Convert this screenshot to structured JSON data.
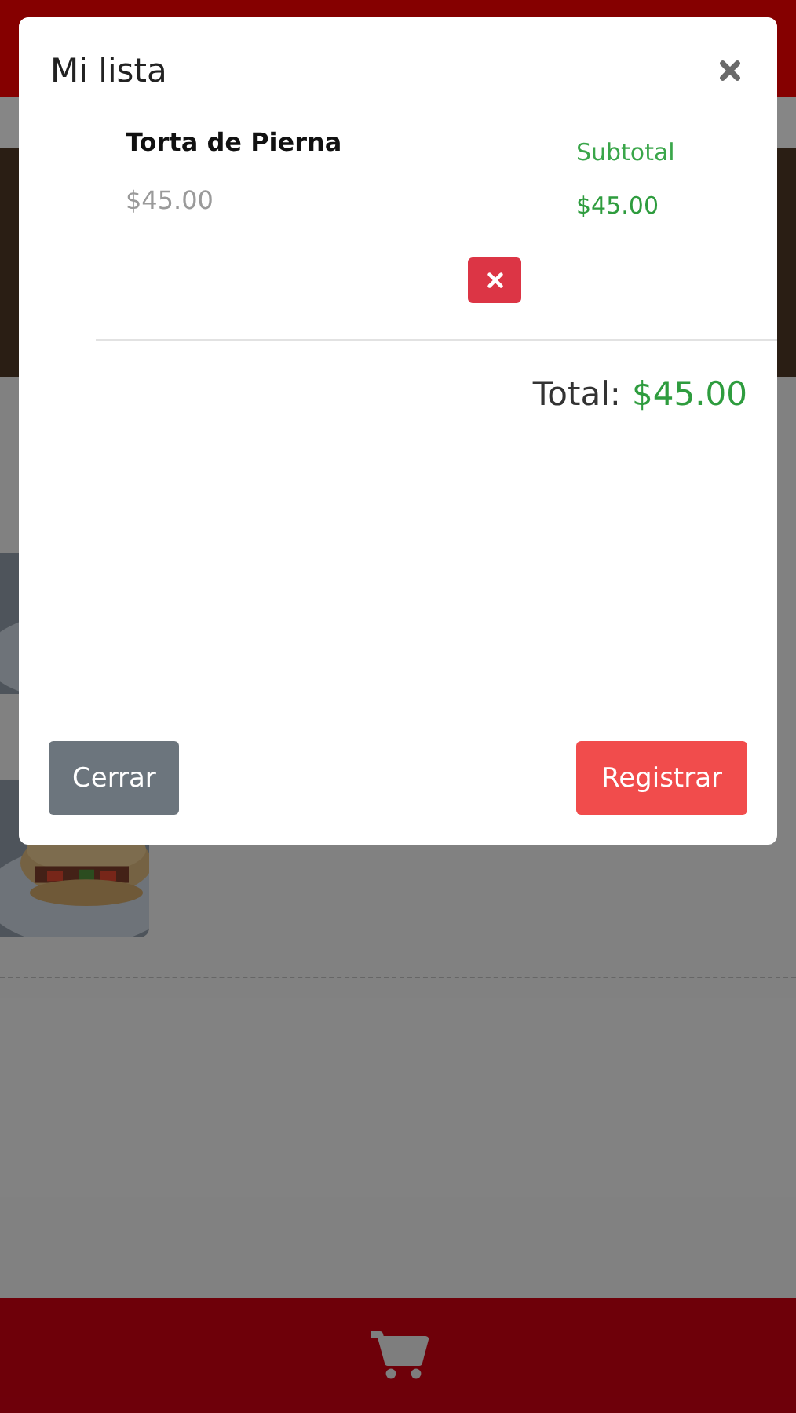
{
  "modal": {
    "title": "Mi lista",
    "items": [
      {
        "name": "Torta de Pierna",
        "price": "$45.00",
        "subtotal_label": "Subtotal",
        "subtotal": "$45.00"
      }
    ],
    "total_label": "Total:",
    "total_value": "$45.00",
    "buttons": [
      {
        "label": "Cerrar",
        "kind": "secondary"
      },
      {
        "label": "Registrar",
        "kind": "primary"
      }
    ]
  }
}
